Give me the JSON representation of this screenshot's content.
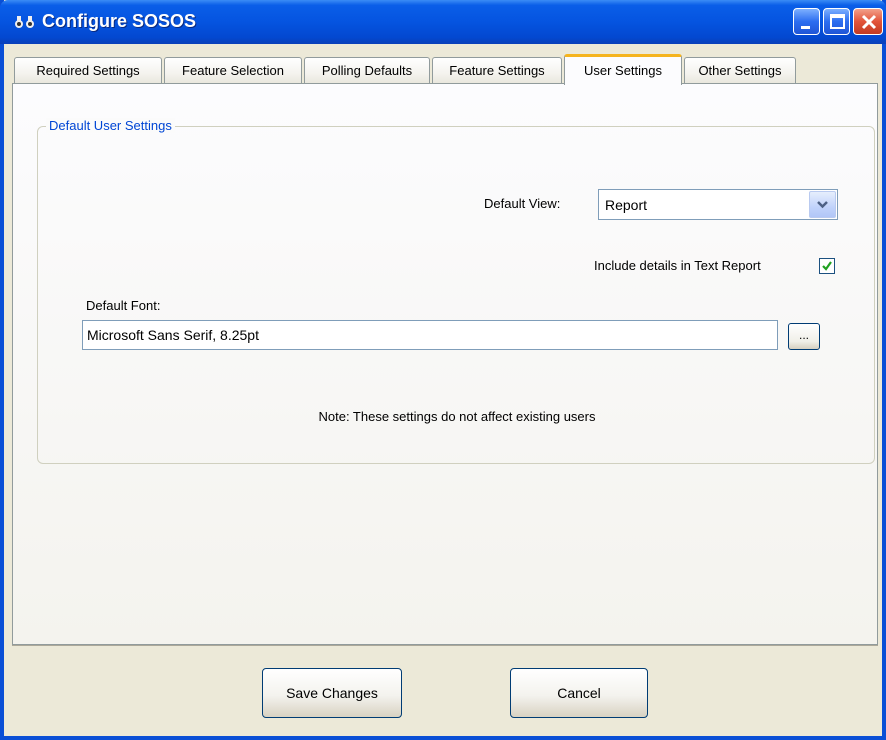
{
  "window": {
    "title": "Configure SOSOS",
    "icon": "binoculars-icon",
    "controls": [
      "minimize-icon",
      "maximize-icon",
      "close-icon"
    ],
    "accent_color": "#0a4fd6"
  },
  "tabs": [
    {
      "label": "Required Settings",
      "active": false
    },
    {
      "label": "Feature Selection",
      "active": false
    },
    {
      "label": "Polling Defaults",
      "active": false
    },
    {
      "label": "Feature Settings",
      "active": false
    },
    {
      "label": "User Settings",
      "active": true
    },
    {
      "label": "Other Settings",
      "active": false
    }
  ],
  "group": {
    "legend": "Default User Settings",
    "legend_color": "#0046d5"
  },
  "default_view": {
    "label": "Default View:",
    "value": "Report"
  },
  "include_details": {
    "label": "Include details in Text Report",
    "checked": true
  },
  "default_font": {
    "label": "Default Font:",
    "value": "Microsoft Sans Serif, 8.25pt",
    "browse_label": "..."
  },
  "note": "Note: These settings do not affect existing users",
  "buttons": {
    "save": "Save Changes",
    "cancel": "Cancel"
  }
}
